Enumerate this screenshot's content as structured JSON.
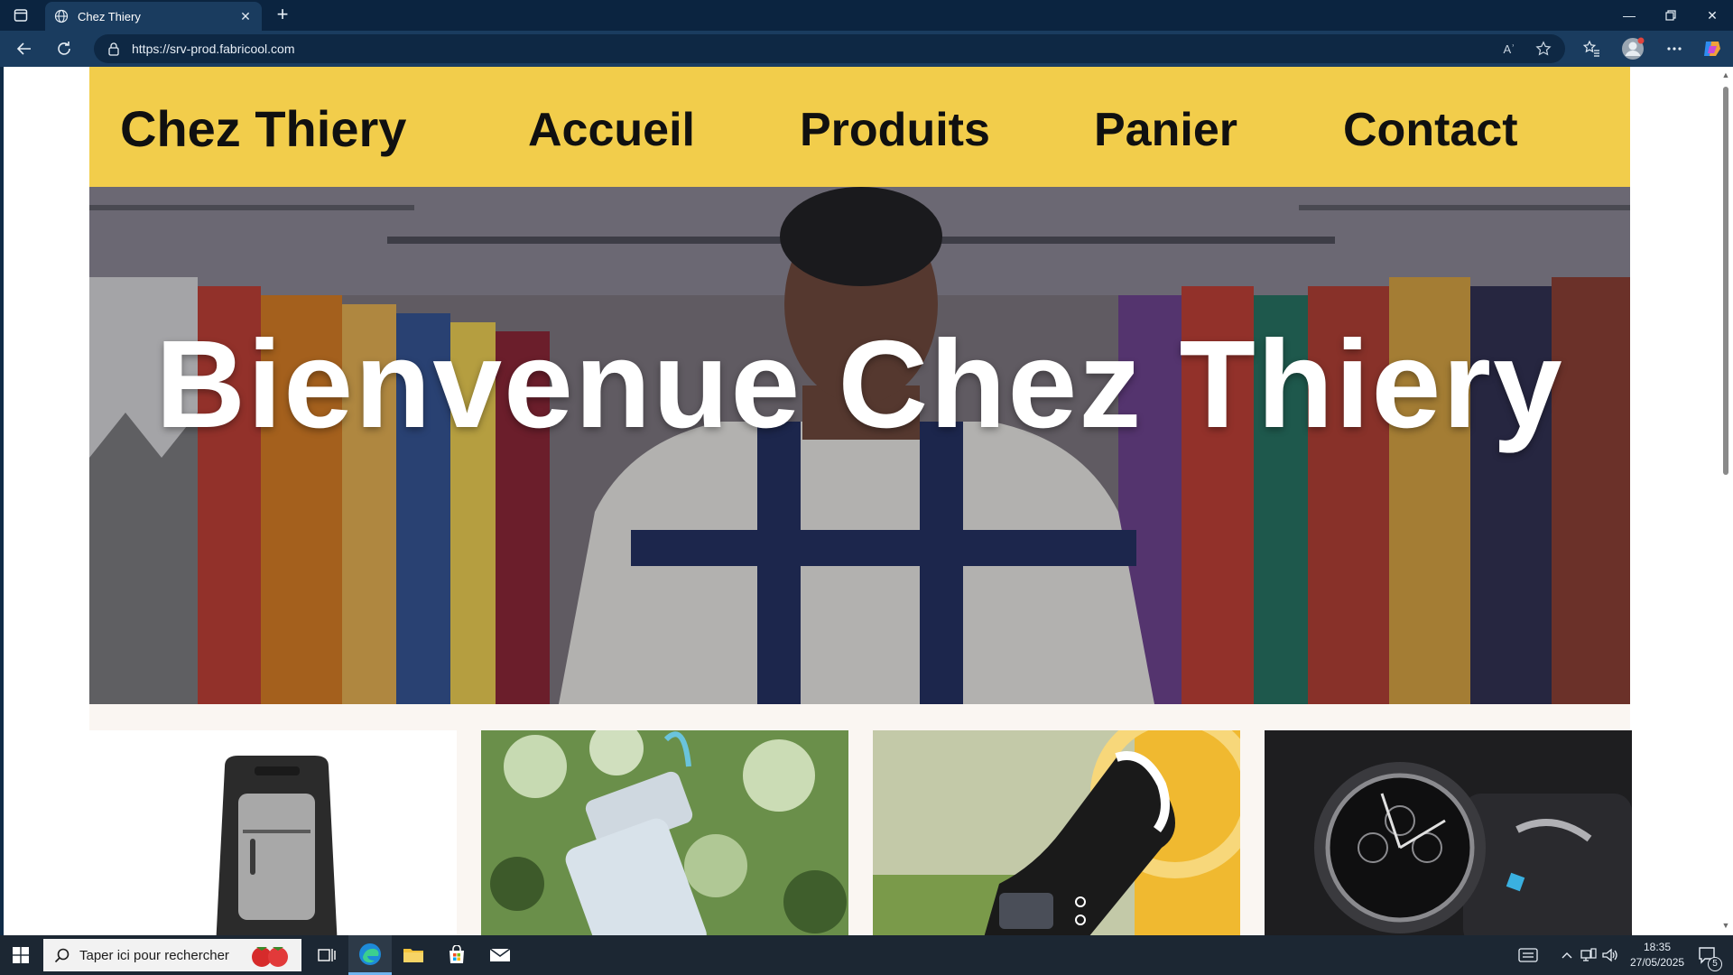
{
  "browser": {
    "tab_title": "Chez Thiery",
    "url": "https://srv-prod.fabricool.com",
    "reader_label": "Aʾ"
  },
  "site": {
    "brand": "Chez Thiery",
    "nav": [
      "Accueil",
      "Produits",
      "Panier",
      "Contact"
    ],
    "hero_title": "Bienvenue Chez Thiery",
    "products": [
      {
        "name": "backpack",
        "icon": "backpack-image"
      },
      {
        "name": "bottle",
        "icon": "water-bottle-image"
      },
      {
        "name": "shoe",
        "icon": "sneaker-image"
      },
      {
        "name": "watch",
        "icon": "wristwatch-image"
      }
    ]
  },
  "taskbar": {
    "search_placeholder": "Taper ici pour rechercher",
    "time": "18:35",
    "date": "27/05/2025",
    "notification_count": "5"
  },
  "colors": {
    "header_yellow": "#f2cd4b",
    "browser_dark": "#0b2440",
    "toolbar_blue": "#1a3c5f"
  }
}
